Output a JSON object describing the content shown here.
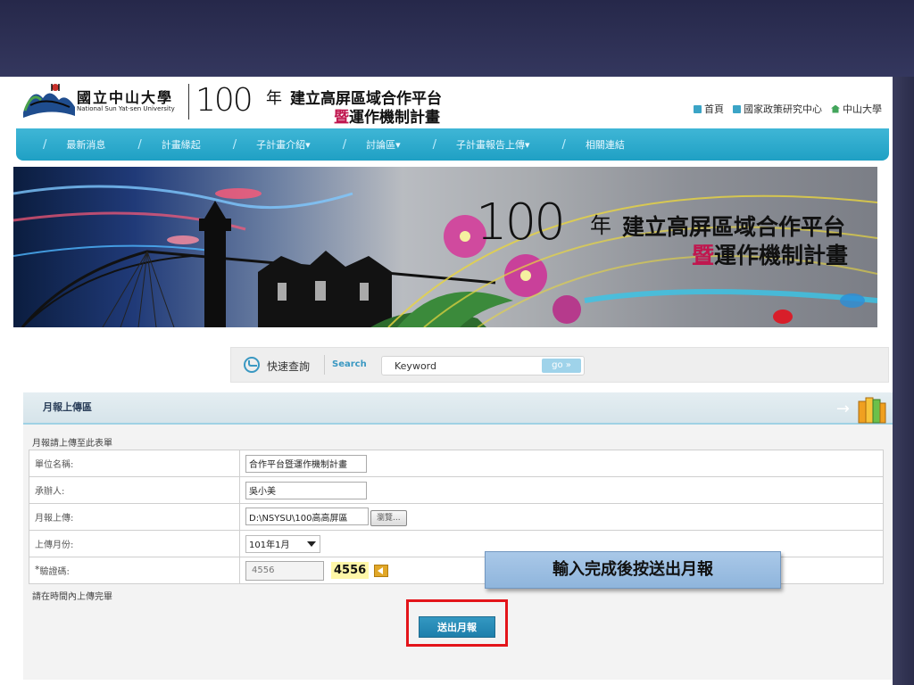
{
  "header": {
    "university_name": "國立中山大學",
    "university_name_en": "National Sun Yat-sen University",
    "year": "100",
    "year_suffix": "年",
    "title_line1": "建立高屏區域合作平台",
    "title_line2_accent": "暨",
    "title_line2_rest": "運作機制計畫",
    "top_links": [
      {
        "label": "首頁",
        "icon": "square-icon"
      },
      {
        "label": "國家政策研究中心",
        "icon": "square-icon"
      },
      {
        "label": "中山大學",
        "icon": "house-icon"
      }
    ]
  },
  "nav": {
    "items": [
      {
        "label": "最新消息"
      },
      {
        "label": "計畫緣起"
      },
      {
        "label": "子計畫介紹▾"
      },
      {
        "label": "討論區▾"
      },
      {
        "label": "子計畫報告上傳▾"
      },
      {
        "label": "相關連結"
      }
    ]
  },
  "banner": {
    "year": "100",
    "year_suffix": "年",
    "title_line1": "建立高屏區域合作平台",
    "title_line2_accent": "暨",
    "title_line2_rest": "運作機制計畫"
  },
  "search": {
    "quick_label": "快速查詢",
    "search_label": "Search",
    "keyword_value": "Keyword",
    "go_label": "go »"
  },
  "panel": {
    "title": "月報上傳區",
    "arrow": "→",
    "form_caption": "月報請上傳至此表單",
    "rows": {
      "unit_label": "單位名稱:",
      "unit_value": "合作平台暨運作機制計畫",
      "contact_label": "承辦人:",
      "contact_value": "吳小美",
      "upload_label": "月報上傳:",
      "upload_value": "D:\\NSYSU\\100高高屏區",
      "browse_label": "瀏覽...",
      "month_label": "上傳月份:",
      "month_value": "101年1月",
      "captcha_label": "驗證碼:",
      "captcha_required": "*",
      "captcha_value": "4556",
      "captcha_image_text": "4556"
    },
    "footnote": "請在時間內上傳完畢",
    "submit_label": "送出月報"
  },
  "callout": {
    "text": "輸入完成後按送出月報"
  },
  "colors": {
    "slide_bg": "#2c2f52",
    "nav_blue": "#2aa9cd",
    "accent_pink": "#c0174f",
    "highlight_red": "#e3141a",
    "callout_blue": "#9dbfe3"
  }
}
